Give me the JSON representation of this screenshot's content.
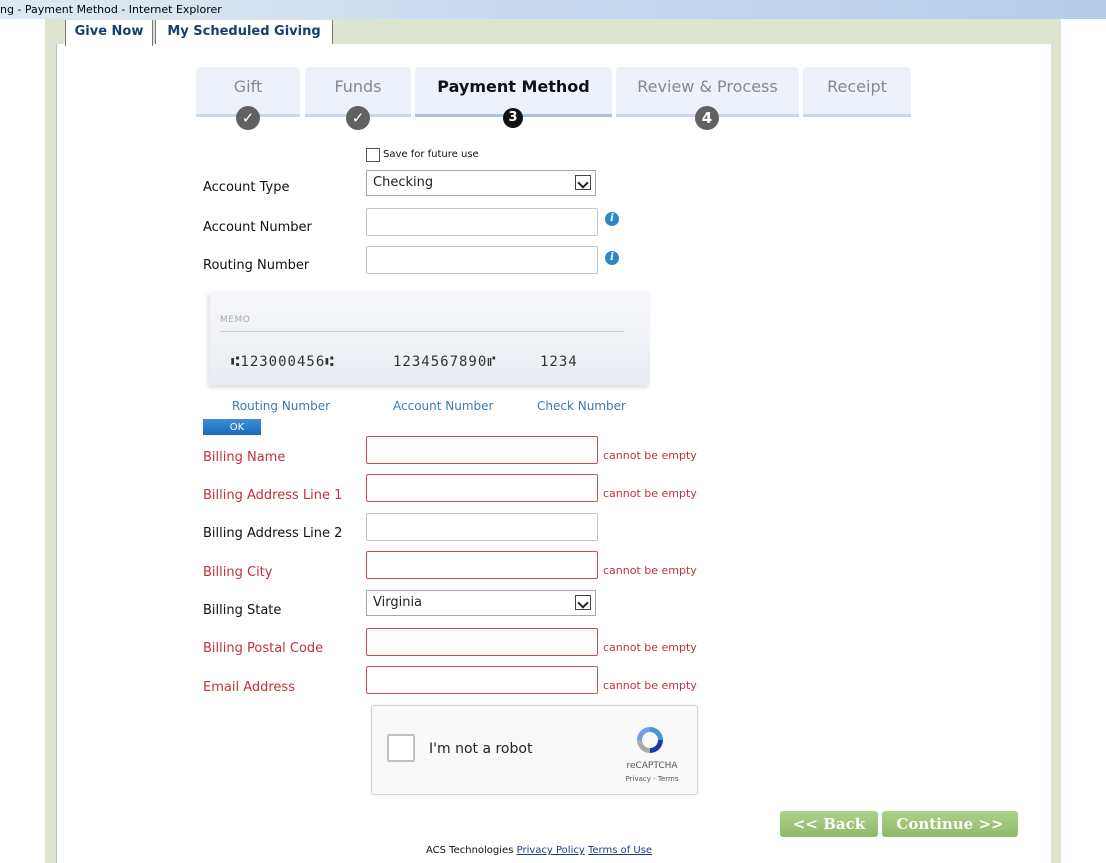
{
  "window": {
    "title": "ng - Payment Method - Internet Explorer"
  },
  "tabs": {
    "give_now": "Give Now",
    "scheduled": "My Scheduled Giving"
  },
  "steps": [
    {
      "label": "Gift",
      "badge": "✓"
    },
    {
      "label": "Funds",
      "badge": "✓"
    },
    {
      "label": "Payment Method",
      "badge": "3"
    },
    {
      "label": "Review & Process",
      "badge": "4"
    },
    {
      "label": "Receipt",
      "badge": ""
    }
  ],
  "form": {
    "save_future": "Save for future use",
    "account_type": {
      "label": "Account Type",
      "value": "Checking"
    },
    "account_number": {
      "label": "Account Number"
    },
    "routing_number": {
      "label": "Routing Number"
    },
    "billing_name": {
      "label": "Billing Name",
      "error": "cannot be empty"
    },
    "billing_address1": {
      "label": "Billing Address Line 1",
      "error": "cannot be empty"
    },
    "billing_address2": {
      "label": "Billing Address Line 2"
    },
    "billing_city": {
      "label": "Billing City",
      "error": "cannot be empty"
    },
    "billing_state": {
      "label": "Billing State",
      "value": "Virginia"
    },
    "billing_postal": {
      "label": "Billing Postal Code",
      "error": "cannot be empty"
    },
    "email": {
      "label": "Email Address",
      "error": "cannot be empty"
    }
  },
  "check": {
    "memo": "MEMO",
    "routing": "⑆123000456⑆",
    "account": "1234567890⑈",
    "check_no": "1234",
    "labels": {
      "routing": "Routing Number",
      "account": "Account Number",
      "check": "Check Number"
    },
    "ok": "OK"
  },
  "recaptcha": {
    "text": "I'm not a robot",
    "brand": "reCAPTCHA",
    "terms": "Privacy - Terms"
  },
  "nav": {
    "back": "<< Back",
    "continue": "Continue >>"
  },
  "footer": {
    "company": "ACS Technologies",
    "privacy": "Privacy Policy",
    "terms": "Terms of Use"
  }
}
